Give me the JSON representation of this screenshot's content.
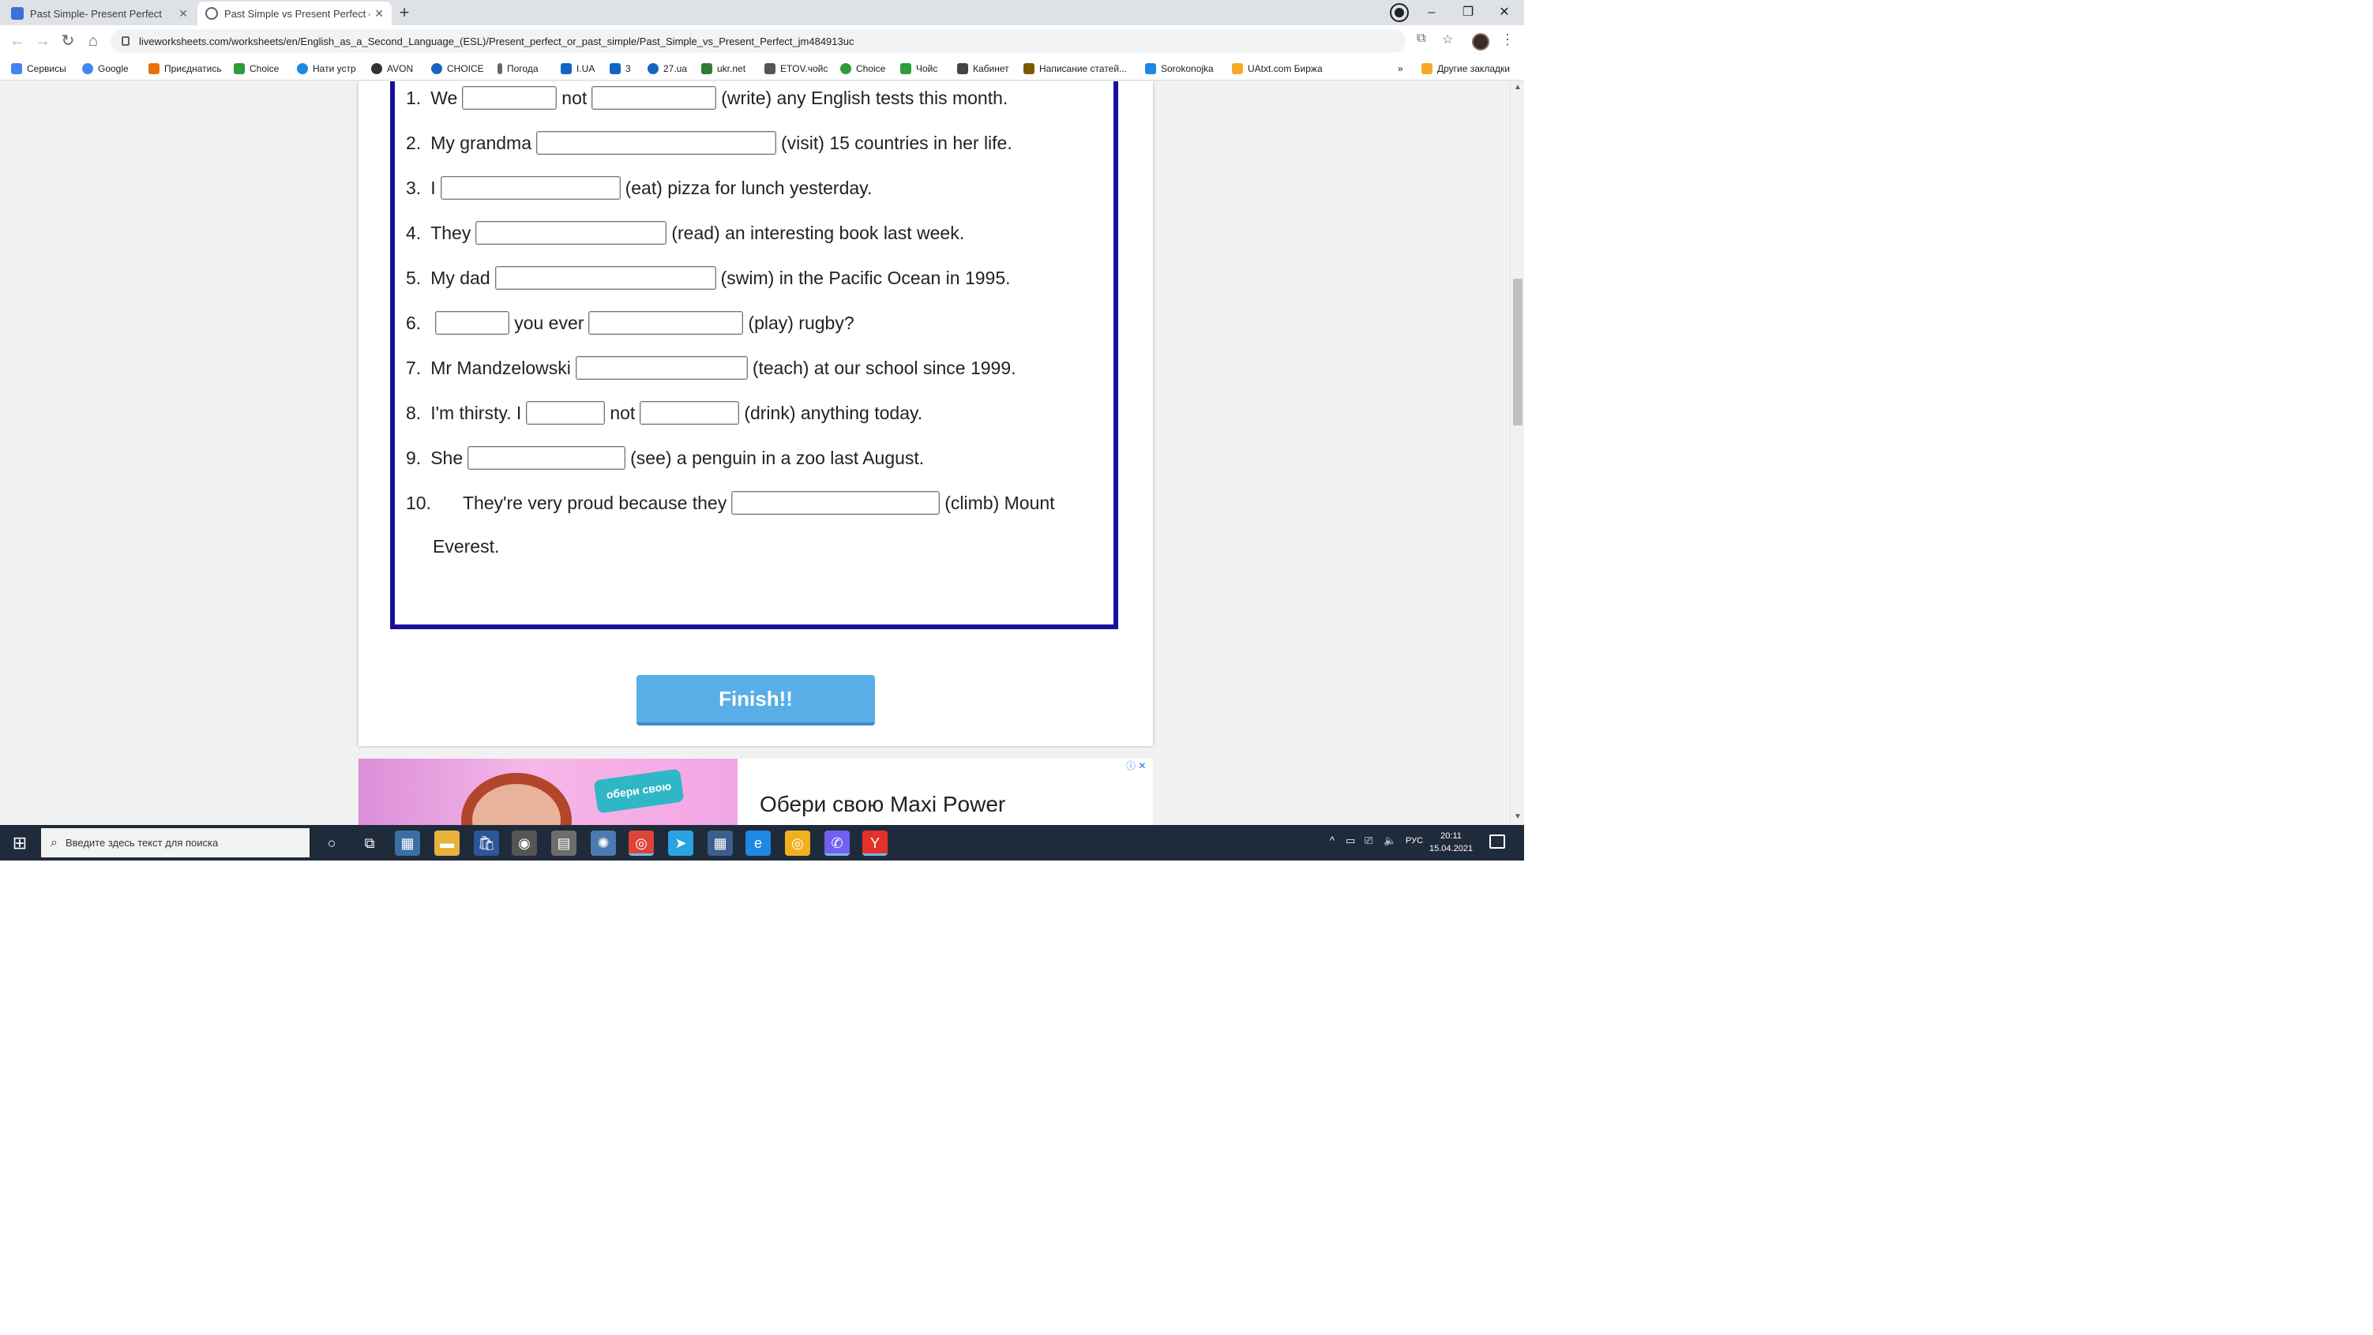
{
  "browser": {
    "tabs": [
      {
        "label": "Past Simple- Present Perfect",
        "favicon_color": "#3c6fd8"
      },
      {
        "label": "Past Simple vs Present Perfect o",
        "favicon_color": "#5f6368"
      }
    ],
    "new_tab_glyph": "+",
    "window_controls": {
      "minimize": "–",
      "restore": "❐",
      "close": "✕"
    },
    "url": "liveworksheets.com/worksheets/en/English_as_a_Second_Language_(ESL)/Present_perfect_or_past_simple/Past_Simple_vs_Present_Perfect_jm484913uc",
    "nav": {
      "back": "←",
      "forward": "→",
      "reload": "↻",
      "home": "⌂"
    },
    "bookmarks": [
      {
        "label": "Сервисы",
        "icon_color": "#4285f4"
      },
      {
        "label": "Google",
        "icon_color": "#4285f4"
      },
      {
        "label": "Приєднатись",
        "icon_color": "#e8710a"
      },
      {
        "label": "Choice",
        "icon_color": "#2e9b3e"
      },
      {
        "label": "Нати устр",
        "icon_color": "#1e88e5"
      },
      {
        "label": "AVON",
        "icon_color": "#333333"
      },
      {
        "label": "CHOICE",
        "icon_color": "#1565c0"
      },
      {
        "label": "Погода",
        "icon_color": "#666666"
      },
      {
        "label": "I.UA",
        "icon_color": "#1565c0"
      },
      {
        "label": "3",
        "icon_color": "#1565c0"
      },
      {
        "label": "27.ua",
        "icon_color": "#1565c0"
      },
      {
        "label": "ukr.net",
        "icon_color": "#2e7d32"
      },
      {
        "label": "ETOV.чойс",
        "icon_color": "#555555"
      },
      {
        "label": "Choice",
        "icon_color": "#2e9b3e"
      },
      {
        "label": "Чойс",
        "icon_color": "#2e9b3e"
      },
      {
        "label": "Кабинет",
        "icon_color": "#444444"
      },
      {
        "label": "Написание статей...",
        "icon_color": "#7b5b00"
      },
      {
        "label": "Sorokonojka",
        "icon_color": "#1e88e5"
      },
      {
        "label": "UAtxt.com Биржа",
        "icon_color": "#f9a825"
      }
    ],
    "bookmarks_overflow": "»",
    "other_bookmarks": "Другие закладки"
  },
  "worksheet": {
    "frame_color": "#1a0f9a",
    "lines": [
      {
        "num": "1.",
        "parts": [
          "We",
          "#gap:120",
          "not",
          "#gap:158",
          "(write) any English tests this month."
        ]
      },
      {
        "num": "2.",
        "parts": [
          "My grandma",
          "#gap:304",
          "(visit) 15 countries in her life."
        ]
      },
      {
        "num": "3.",
        "parts": [
          "I",
          "#gap:228",
          "(eat) pizza for lunch yesterday."
        ]
      },
      {
        "num": "4.",
        "parts": [
          "They",
          "#gap:242",
          "(read) an interesting book last week."
        ]
      },
      {
        "num": "5.",
        "parts": [
          "My dad",
          "#gap:280",
          "(swim) in the Pacific Ocean in 1995."
        ]
      },
      {
        "num": "6.",
        "parts": [
          "#gap:94",
          "you ever",
          "#gap:196",
          "(play) rugby?"
        ]
      },
      {
        "num": "7.",
        "parts": [
          "Mr Mandzelowski",
          "#gap:218",
          "(teach) at our school since 1999."
        ]
      },
      {
        "num": "8.",
        "parts": [
          "I'm thirsty. I",
          "#gap:100",
          "not",
          "#gap:126",
          "(drink) anything today."
        ]
      },
      {
        "num": "9.",
        "parts": [
          "She",
          "#gap:200",
          "(see) a penguin in a zoo last August."
        ]
      },
      {
        "num": "10.",
        "parts": [
          "They're very proud because they",
          "#gap:264",
          "(climb) Mount"
        ]
      }
    ],
    "continuation": "Everest.",
    "finish_label": "Finish!!"
  },
  "ad": {
    "headline": "Обери свою Maxi Power",
    "sticker": "обери свою",
    "choices_glyph": "ⓘ ✕"
  },
  "taskbar": {
    "search_placeholder": "Введите здесь текст для поиска",
    "language": "РУС",
    "time": "20:11",
    "date": "15.04.2021",
    "apps": [
      {
        "name": "cortana",
        "glyph": "○",
        "color": "transparent"
      },
      {
        "name": "task-view",
        "glyph": "⧉",
        "color": "transparent"
      },
      {
        "name": "calculator",
        "glyph": "▦",
        "color": "#3a6ea5"
      },
      {
        "name": "file-explorer",
        "glyph": "▬",
        "color": "#e8b33a"
      },
      {
        "name": "store",
        "glyph": "🛍",
        "color": "#2b579a"
      },
      {
        "name": "media",
        "glyph": "◉",
        "color": "#555555"
      },
      {
        "name": "photos",
        "glyph": "▤",
        "color": "#6d6d6d"
      },
      {
        "name": "network",
        "glyph": "✺",
        "color": "#4a7ab0"
      },
      {
        "name": "chrome",
        "glyph": "◎",
        "color": "#db4437"
      },
      {
        "name": "telegram",
        "glyph": "➤",
        "color": "#2aa3e0"
      },
      {
        "name": "calc2",
        "glyph": "▦",
        "color": "#3a5f8f"
      },
      {
        "name": "edge",
        "glyph": "e",
        "color": "#1e88e5"
      },
      {
        "name": "chrome-canary",
        "glyph": "◎",
        "color": "#f2b01e"
      },
      {
        "name": "viber",
        "glyph": "✆",
        "color": "#7360f2"
      },
      {
        "name": "yandex",
        "glyph": "Y",
        "color": "#e4322b"
      }
    ]
  }
}
